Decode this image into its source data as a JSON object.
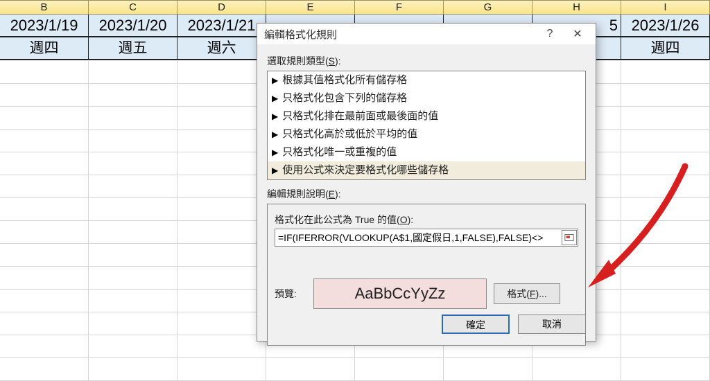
{
  "columns": [
    "B",
    "C",
    "D",
    "E",
    "F",
    "G",
    "H",
    "I"
  ],
  "row_edge_after": "5",
  "row_edge_trail": "2",
  "dates": [
    "2023/1/19",
    "2023/1/20",
    "2023/1/21",
    "",
    "",
    "",
    "",
    "2023/1/26"
  ],
  "days": [
    "週四",
    "週五",
    "週六",
    "",
    "",
    "",
    "",
    "週四"
  ],
  "dialog": {
    "title": "編輯格式化規則",
    "help": "?",
    "close": "✕",
    "rule_type_label_pre": "選取規則類型(",
    "rule_type_label_u": "S",
    "rule_type_label_post": "):",
    "rules": [
      "根據其值格式化所有儲存格",
      "只格式化包含下列的儲存格",
      "只格式化排在最前面或最後面的值",
      "只格式化高於或低於平均的值",
      "只格式化唯一或重複的值",
      "使用公式來決定要格式化哪些儲存格"
    ],
    "selected_rule_index": 5,
    "desc_label_pre": "編輯規則說明(",
    "desc_label_u": "E",
    "desc_label_post": "):",
    "formula_label_pre": "格式化在此公式為 True 的值(",
    "formula_label_u": "O",
    "formula_label_post": "):",
    "formula_value": "=IF(IFERROR(VLOOKUP(A$1,國定假日,1,FALSE),FALSE)<>",
    "preview_label": "預覽:",
    "preview_text": "AaBbCcYyZz",
    "format_btn_pre": "格式(",
    "format_btn_u": "F",
    "format_btn_post": ")...",
    "ok": "確定",
    "cancel": "取消"
  }
}
